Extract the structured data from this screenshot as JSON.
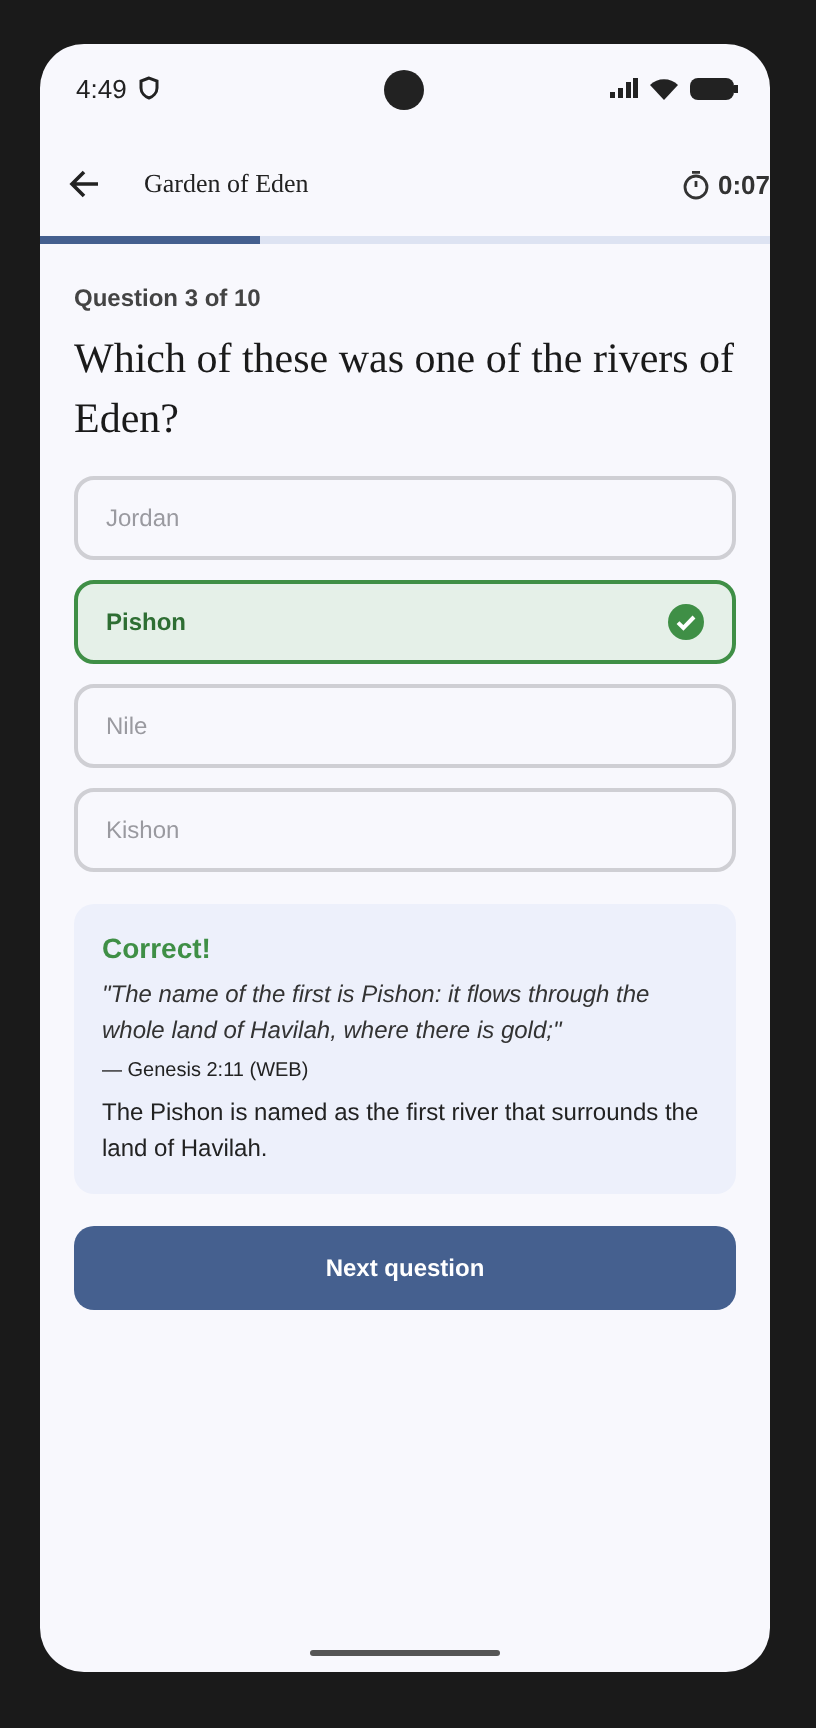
{
  "status_bar": {
    "time": "4:49"
  },
  "app_bar": {
    "title": "Garden of Eden",
    "timer": "0:07"
  },
  "progress": {
    "level": 0.3
  },
  "question": {
    "counter": "Question 3 of 10",
    "text": "Which of these was one of the rivers of Eden?"
  },
  "options": [
    {
      "label": "Jordan",
      "selected": false,
      "disabled": true
    },
    {
      "label": "Pishon",
      "selected": true,
      "disabled": false
    },
    {
      "label": "Nile",
      "selected": false,
      "disabled": true
    },
    {
      "label": "Kishon",
      "selected": false,
      "disabled": true
    }
  ],
  "feedback": {
    "title": "Correct!",
    "quote": "\"The name of the first is Pishon: it flows through the whole land of Havilah, where there is gold;\"",
    "reference": "— Genesis 2:11 (WEB)",
    "explanation": "The Pishon is named as the first river that surrounds the land of Havilah."
  },
  "next_button": "Next question"
}
